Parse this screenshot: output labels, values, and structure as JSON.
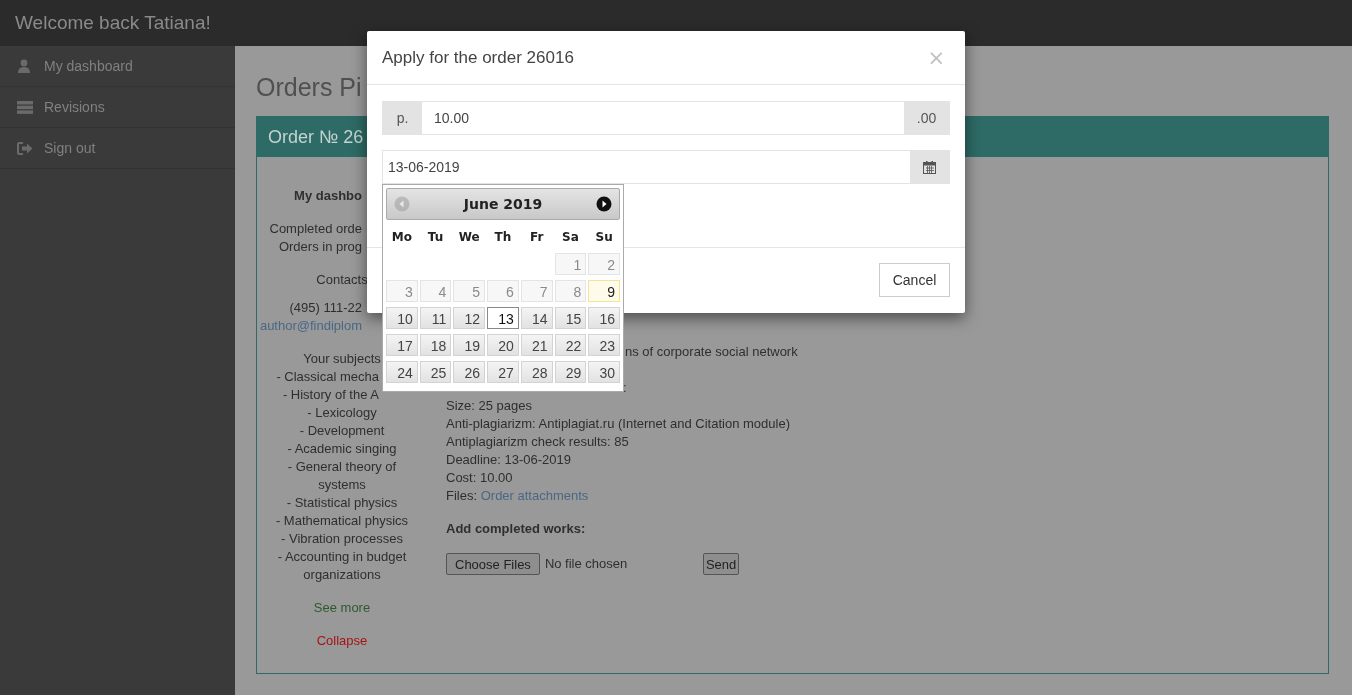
{
  "header": {
    "title": "Welcome back Tatiana!"
  },
  "sidebar": {
    "items": [
      {
        "label": "My dashboard"
      },
      {
        "label": "Revisions"
      },
      {
        "label": "Sign out"
      }
    ]
  },
  "page": {
    "title": "Orders Pi"
  },
  "order_panel": {
    "title": "Order № 26",
    "info_column": {
      "heading": "My dashbo",
      "stats": [
        "Completed orde",
        "Orders in prog"
      ],
      "contacts_heading": "Contacts",
      "phone": "(495) 111-22",
      "email": "author@findiplom",
      "subjects_heading": "Your subjects",
      "subjects": [
        "- Classical mecha",
        "- History of the A",
        "- Lexicology",
        "- Development",
        "- Academic singing",
        "- General theory of systems",
        "- Statistical physics",
        "- Mathematical physics",
        "- Vibration processes",
        "- Accounting in budget organizations"
      ],
      "see_more": "See more",
      "collapse": "Collapse"
    },
    "details": {
      "topic_fragment": "ns of corporate social network",
      "line_fragment": ":",
      "lines": [
        "Size: 25 pages",
        "Anti-plagiarizm: Antiplagiat.ru (Internet and Citation module)",
        "Antiplagiarizm check results: 85",
        "Deadline: 13-06-2019",
        "Cost: 10.00"
      ],
      "files": {
        "label": "Files:",
        "link": "Order attachments"
      },
      "upload": {
        "heading": "Add completed works:",
        "choose_button": "Choose Files",
        "file_status": "No file chosen",
        "send_button": "Send"
      }
    }
  },
  "modal": {
    "title": "Apply for the order 26016",
    "close": "×",
    "price": {
      "prefix": "p.",
      "value": "10.00",
      "suffix": ".00"
    },
    "date": {
      "value": "13-06-2019"
    },
    "cancel": "Cancel"
  },
  "datepicker": {
    "title": "June 2019",
    "prev": {
      "disabled": true
    },
    "next": {
      "disabled": false
    },
    "weekdays": [
      "Mo",
      "Tu",
      "We",
      "Th",
      "Fr",
      "Sa",
      "Su"
    ],
    "weeks": [
      [
        {
          "label": "1",
          "disabled": true,
          "today": false,
          "selected": false
        },
        {
          "label": "2",
          "disabled": true,
          "today": false,
          "selected": false
        }
      ],
      [
        {
          "label": "3",
          "disabled": true,
          "today": false,
          "selected": false
        },
        {
          "label": "4",
          "disabled": true,
          "today": false,
          "selected": false
        },
        {
          "label": "5",
          "disabled": true,
          "today": false,
          "selected": false
        },
        {
          "label": "6",
          "disabled": true,
          "today": false,
          "selected": false
        },
        {
          "label": "7",
          "disabled": true,
          "today": false,
          "selected": false
        },
        {
          "label": "8",
          "disabled": true,
          "today": false,
          "selected": false
        },
        {
          "label": "9",
          "disabled": false,
          "today": true,
          "selected": false
        }
      ],
      [
        {
          "label": "10",
          "disabled": false,
          "today": false,
          "selected": false
        },
        {
          "label": "11",
          "disabled": false,
          "today": false,
          "selected": false
        },
        {
          "label": "12",
          "disabled": false,
          "today": false,
          "selected": false
        },
        {
          "label": "13",
          "disabled": false,
          "today": false,
          "selected": true
        },
        {
          "label": "14",
          "disabled": false,
          "today": false,
          "selected": false
        },
        {
          "label": "15",
          "disabled": false,
          "today": false,
          "selected": false
        },
        {
          "label": "16",
          "disabled": false,
          "today": false,
          "selected": false
        }
      ],
      [
        {
          "label": "17",
          "disabled": false,
          "today": false,
          "selected": false
        },
        {
          "label": "18",
          "disabled": false,
          "today": false,
          "selected": false
        },
        {
          "label": "19",
          "disabled": false,
          "today": false,
          "selected": false
        },
        {
          "label": "20",
          "disabled": false,
          "today": false,
          "selected": false
        },
        {
          "label": "21",
          "disabled": false,
          "today": false,
          "selected": false
        },
        {
          "label": "22",
          "disabled": false,
          "today": false,
          "selected": false
        },
        {
          "label": "23",
          "disabled": false,
          "today": false,
          "selected": false
        }
      ],
      [
        {
          "label": "24",
          "disabled": false,
          "today": false,
          "selected": false
        },
        {
          "label": "25",
          "disabled": false,
          "today": false,
          "selected": false
        },
        {
          "label": "26",
          "disabled": false,
          "today": false,
          "selected": false
        },
        {
          "label": "27",
          "disabled": false,
          "today": false,
          "selected": false
        },
        {
          "label": "28",
          "disabled": false,
          "today": false,
          "selected": false
        },
        {
          "label": "29",
          "disabled": false,
          "today": false,
          "selected": false
        },
        {
          "label": "30",
          "disabled": false,
          "today": false,
          "selected": false
        }
      ]
    ]
  }
}
